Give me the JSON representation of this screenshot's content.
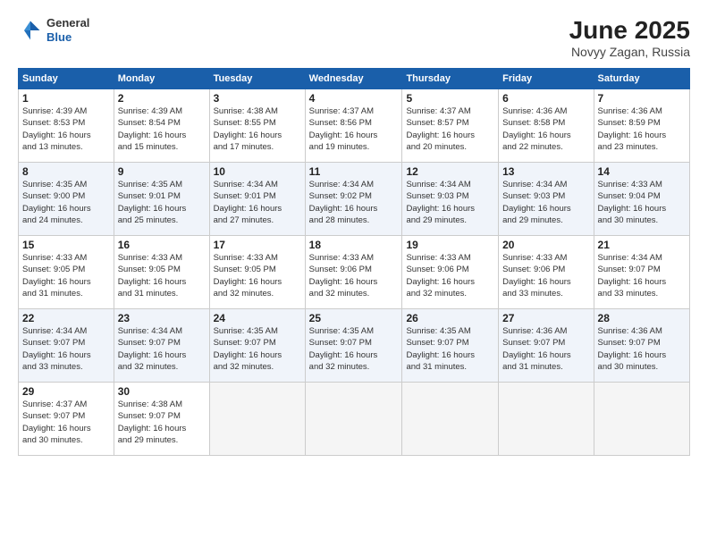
{
  "header": {
    "logo": {
      "general": "General",
      "blue": "Blue"
    },
    "title": "June 2025",
    "location": "Novyy Zagan, Russia"
  },
  "weekdays": [
    "Sunday",
    "Monday",
    "Tuesday",
    "Wednesday",
    "Thursday",
    "Friday",
    "Saturday"
  ],
  "weeks": [
    [
      {
        "day": 1,
        "info": "Sunrise: 4:39 AM\nSunset: 8:53 PM\nDaylight: 16 hours\nand 13 minutes."
      },
      {
        "day": 2,
        "info": "Sunrise: 4:39 AM\nSunset: 8:54 PM\nDaylight: 16 hours\nand 15 minutes."
      },
      {
        "day": 3,
        "info": "Sunrise: 4:38 AM\nSunset: 8:55 PM\nDaylight: 16 hours\nand 17 minutes."
      },
      {
        "day": 4,
        "info": "Sunrise: 4:37 AM\nSunset: 8:56 PM\nDaylight: 16 hours\nand 19 minutes."
      },
      {
        "day": 5,
        "info": "Sunrise: 4:37 AM\nSunset: 8:57 PM\nDaylight: 16 hours\nand 20 minutes."
      },
      {
        "day": 6,
        "info": "Sunrise: 4:36 AM\nSunset: 8:58 PM\nDaylight: 16 hours\nand 22 minutes."
      },
      {
        "day": 7,
        "info": "Sunrise: 4:36 AM\nSunset: 8:59 PM\nDaylight: 16 hours\nand 23 minutes."
      }
    ],
    [
      {
        "day": 8,
        "info": "Sunrise: 4:35 AM\nSunset: 9:00 PM\nDaylight: 16 hours\nand 24 minutes."
      },
      {
        "day": 9,
        "info": "Sunrise: 4:35 AM\nSunset: 9:01 PM\nDaylight: 16 hours\nand 25 minutes."
      },
      {
        "day": 10,
        "info": "Sunrise: 4:34 AM\nSunset: 9:01 PM\nDaylight: 16 hours\nand 27 minutes."
      },
      {
        "day": 11,
        "info": "Sunrise: 4:34 AM\nSunset: 9:02 PM\nDaylight: 16 hours\nand 28 minutes."
      },
      {
        "day": 12,
        "info": "Sunrise: 4:34 AM\nSunset: 9:03 PM\nDaylight: 16 hours\nand 29 minutes."
      },
      {
        "day": 13,
        "info": "Sunrise: 4:34 AM\nSunset: 9:03 PM\nDaylight: 16 hours\nand 29 minutes."
      },
      {
        "day": 14,
        "info": "Sunrise: 4:33 AM\nSunset: 9:04 PM\nDaylight: 16 hours\nand 30 minutes."
      }
    ],
    [
      {
        "day": 15,
        "info": "Sunrise: 4:33 AM\nSunset: 9:05 PM\nDaylight: 16 hours\nand 31 minutes."
      },
      {
        "day": 16,
        "info": "Sunrise: 4:33 AM\nSunset: 9:05 PM\nDaylight: 16 hours\nand 31 minutes."
      },
      {
        "day": 17,
        "info": "Sunrise: 4:33 AM\nSunset: 9:05 PM\nDaylight: 16 hours\nand 32 minutes."
      },
      {
        "day": 18,
        "info": "Sunrise: 4:33 AM\nSunset: 9:06 PM\nDaylight: 16 hours\nand 32 minutes."
      },
      {
        "day": 19,
        "info": "Sunrise: 4:33 AM\nSunset: 9:06 PM\nDaylight: 16 hours\nand 32 minutes."
      },
      {
        "day": 20,
        "info": "Sunrise: 4:33 AM\nSunset: 9:06 PM\nDaylight: 16 hours\nand 33 minutes."
      },
      {
        "day": 21,
        "info": "Sunrise: 4:34 AM\nSunset: 9:07 PM\nDaylight: 16 hours\nand 33 minutes."
      }
    ],
    [
      {
        "day": 22,
        "info": "Sunrise: 4:34 AM\nSunset: 9:07 PM\nDaylight: 16 hours\nand 33 minutes."
      },
      {
        "day": 23,
        "info": "Sunrise: 4:34 AM\nSunset: 9:07 PM\nDaylight: 16 hours\nand 32 minutes."
      },
      {
        "day": 24,
        "info": "Sunrise: 4:35 AM\nSunset: 9:07 PM\nDaylight: 16 hours\nand 32 minutes."
      },
      {
        "day": 25,
        "info": "Sunrise: 4:35 AM\nSunset: 9:07 PM\nDaylight: 16 hours\nand 32 minutes."
      },
      {
        "day": 26,
        "info": "Sunrise: 4:35 AM\nSunset: 9:07 PM\nDaylight: 16 hours\nand 31 minutes."
      },
      {
        "day": 27,
        "info": "Sunrise: 4:36 AM\nSunset: 9:07 PM\nDaylight: 16 hours\nand 31 minutes."
      },
      {
        "day": 28,
        "info": "Sunrise: 4:36 AM\nSunset: 9:07 PM\nDaylight: 16 hours\nand 30 minutes."
      }
    ],
    [
      {
        "day": 29,
        "info": "Sunrise: 4:37 AM\nSunset: 9:07 PM\nDaylight: 16 hours\nand 30 minutes."
      },
      {
        "day": 30,
        "info": "Sunrise: 4:38 AM\nSunset: 9:07 PM\nDaylight: 16 hours\nand 29 minutes."
      },
      null,
      null,
      null,
      null,
      null
    ]
  ]
}
